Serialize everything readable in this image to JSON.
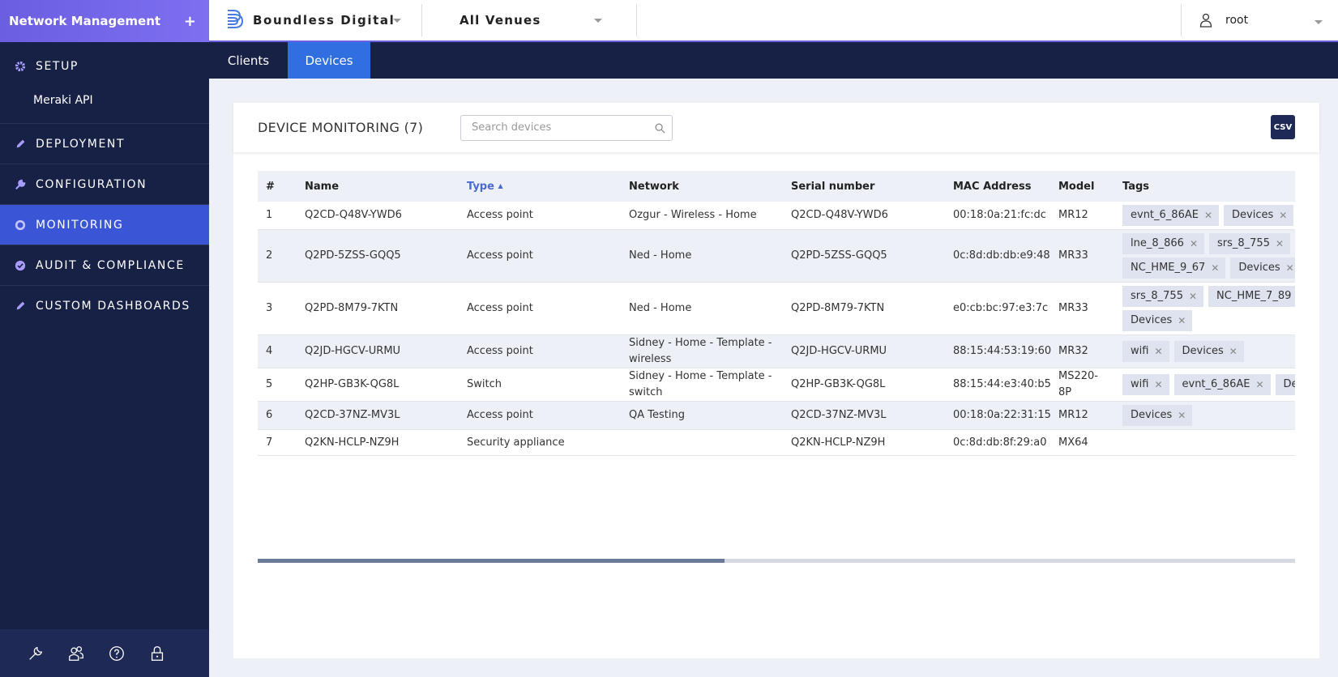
{
  "sidebar": {
    "title": "Network Management",
    "add_icon": "plus-icon",
    "setup": {
      "label": "SETUP",
      "icon": "gear-icon",
      "sub": "Meraki API"
    },
    "items": [
      {
        "label": "DEPLOYMENT",
        "icon": "pencil-icon"
      },
      {
        "label": "CONFIGURATION",
        "icon": "wrench-icon"
      },
      {
        "label": "MONITORING",
        "icon": "ring-icon",
        "active": true
      },
      {
        "label": "AUDIT & COMPLIANCE",
        "icon": "check-circle-icon"
      },
      {
        "label": "CUSTOM DASHBOARDS",
        "icon": "pencil-icon"
      }
    ],
    "footer_icons": [
      "wrench-icon",
      "users-icon",
      "help-icon",
      "lock-icon"
    ]
  },
  "topbar": {
    "org_name": "Boundless Digital",
    "venue": "All Venues",
    "user": "root"
  },
  "tabs": [
    {
      "label": "Clients"
    },
    {
      "label": "Devices",
      "active": true
    }
  ],
  "panel": {
    "title": "DEVICE MONITORING (7)",
    "search_placeholder": "Search devices",
    "csv_label": "CSV"
  },
  "table": {
    "columns": [
      "#",
      "Name",
      "Type",
      "Network",
      "Serial number",
      "MAC Address",
      "Model",
      "Tags"
    ],
    "sorted_column": "Type",
    "rows": [
      {
        "num": "1",
        "name": "Q2CD-Q48V-YWD6",
        "type": "Access point",
        "network": "Ozgur - Wireless - Home",
        "serial": "Q2CD-Q48V-YWD6",
        "mac": "00:18:0a:21:fc:dc",
        "model": "MR12",
        "tags": [
          "evnt_6_86AE",
          "Devices"
        ]
      },
      {
        "num": "2",
        "name": "Q2PD-5ZSS-GQQ5",
        "type": "Access point",
        "network": "Ned - Home",
        "serial": "Q2PD-5ZSS-GQQ5",
        "mac": "0c:8d:db:db:e9:48",
        "model": "MR33",
        "tags": [
          "lne_8_866",
          "srs_8_755",
          "NC_HME_9_67",
          "Devices"
        ]
      },
      {
        "num": "3",
        "name": "Q2PD-8M79-7KTN",
        "type": "Access point",
        "network": "Ned - Home",
        "serial": "Q2PD-8M79-7KTN",
        "mac": "e0:cb:bc:97:e3:7c",
        "model": "MR33",
        "tags": [
          "srs_8_755",
          "NC_HME_7_89",
          "Devices"
        ]
      },
      {
        "num": "4",
        "name": "Q2JD-HGCV-URMU",
        "type": "Access point",
        "network": "Sidney - Home - Template - wireless",
        "serial": "Q2JD-HGCV-URMU",
        "mac": "88:15:44:53:19:60",
        "model": "MR32",
        "tags": [
          "wifi",
          "Devices"
        ]
      },
      {
        "num": "5",
        "name": "Q2HP-GB3K-QG8L",
        "type": "Switch",
        "network": "Sidney - Home - Template - switch",
        "serial": "Q2HP-GB3K-QG8L",
        "mac": "88:15:44:e3:40:b5",
        "model": "MS220-8P",
        "tags": [
          "wifi",
          "evnt_6_86AE",
          "Devices"
        ]
      },
      {
        "num": "6",
        "name": "Q2CD-37NZ-MV3L",
        "type": "Access point",
        "network": "QA Testing",
        "serial": "Q2CD-37NZ-MV3L",
        "mac": "00:18:0a:22:31:15",
        "model": "MR12",
        "tags": [
          "Devices"
        ]
      },
      {
        "num": "7",
        "name": "Q2KN-HCLP-NZ9H",
        "type": "Security appliance",
        "network": "",
        "serial": "Q2KN-HCLP-NZ9H",
        "mac": "0c:8d:db:8f:29:a0",
        "model": "MX64",
        "tags": []
      }
    ]
  },
  "scroll": {
    "horizontal_position": 0.45
  }
}
